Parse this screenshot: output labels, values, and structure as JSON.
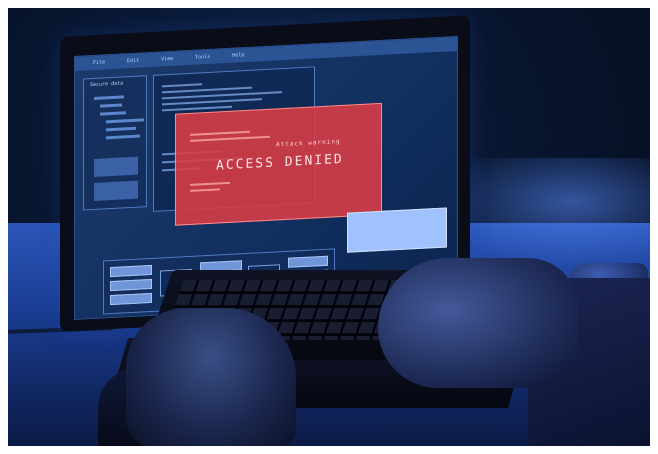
{
  "screen": {
    "menu": [
      "File",
      "Edit",
      "View",
      "Tools",
      "Help"
    ],
    "side_panel_title": "Secure data",
    "alert": {
      "caption": "Attack warning",
      "title": "ACCESS DENIED",
      "color": "#e03c46"
    },
    "status_box_color": "#9fc2ff"
  },
  "scene": {
    "desk_color": "#2a56b8",
    "background_color": "#081630"
  }
}
